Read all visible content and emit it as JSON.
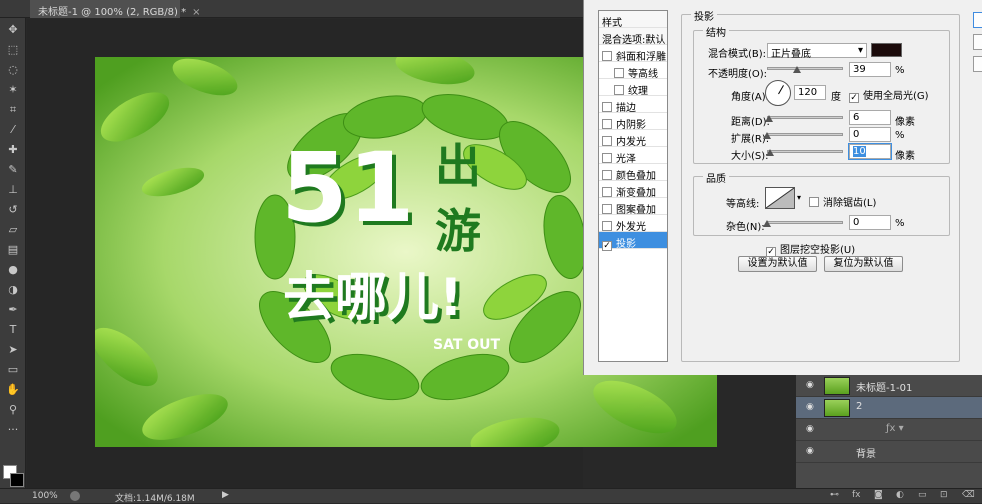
{
  "document": {
    "tab_title": "未标题-1 @ 100% (2, RGB/8) *",
    "tab_close": "×"
  },
  "status": {
    "zoom": "100%",
    "doc_size": "文档:1.14M/6.18M",
    "arrow": "▶"
  },
  "artwork": {
    "big_number": "51",
    "title_chars_right": [
      "出",
      "游"
    ],
    "title_bottom": "去哪儿!",
    "subtitle": "SAT OUT"
  },
  "styles_panel": {
    "header": "样式",
    "blend_default": "混合选项:默认",
    "items": [
      {
        "label": "斜面和浮雕",
        "checked": false,
        "indent": false
      },
      {
        "label": "等高线",
        "checked": false,
        "indent": true
      },
      {
        "label": "纹理",
        "checked": false,
        "indent": true
      },
      {
        "label": "描边",
        "checked": false,
        "indent": false
      },
      {
        "label": "内阴影",
        "checked": false,
        "indent": false
      },
      {
        "label": "内发光",
        "checked": false,
        "indent": false
      },
      {
        "label": "光泽",
        "checked": false,
        "indent": false
      },
      {
        "label": "颜色叠加",
        "checked": false,
        "indent": false
      },
      {
        "label": "渐变叠加",
        "checked": false,
        "indent": false
      },
      {
        "label": "图案叠加",
        "checked": false,
        "indent": false
      },
      {
        "label": "外发光",
        "checked": false,
        "indent": false
      },
      {
        "label": "投影",
        "checked": true,
        "indent": false
      }
    ]
  },
  "drop_shadow": {
    "section_title": "投影",
    "structure_title": "结构",
    "blend_mode_label": "混合模式(B):",
    "blend_mode_value": "正片叠底",
    "shadow_color": "#1a0a0a",
    "opacity_label": "不透明度(O):",
    "opacity_value": "39",
    "opacity_unit": "%",
    "opacity_fraction": 0.39,
    "angle_label": "角度(A):",
    "angle_value": "120",
    "angle_unit": "度",
    "global_light_label": "使用全局光(G)",
    "global_light_checked": true,
    "distance_label": "距离(D):",
    "distance_value": "6",
    "distance_unit": "像素",
    "distance_fraction": 0.02,
    "spread_label": "扩展(R):",
    "spread_value": "0",
    "spread_unit": "%",
    "spread_fraction": 0.0,
    "size_label": "大小(S):",
    "size_value": "10",
    "size_unit": "像素",
    "size_fraction": 0.04,
    "quality_title": "品质",
    "contour_label": "等高线:",
    "anti_alias_label": "消除锯齿(L)",
    "anti_alias_checked": false,
    "noise_label": "杂色(N):",
    "noise_value": "0",
    "noise_unit": "%",
    "noise_fraction": 0.0,
    "knockout_label": "图层挖空投影(U)",
    "knockout_checked": true,
    "make_default_label": "设置为默认值",
    "reset_default_label": "复位为默认值"
  },
  "layers": [
    {
      "name": "未标题-1-01",
      "selected": false
    },
    {
      "name": "2",
      "selected": true
    },
    {
      "name": "",
      "selected": false
    },
    {
      "name": "背景",
      "selected": false
    }
  ],
  "colors": {
    "accent_blue": "#3e8fe0",
    "leaf_green": "#6cc12c",
    "dark_green": "#1f7a1f"
  }
}
